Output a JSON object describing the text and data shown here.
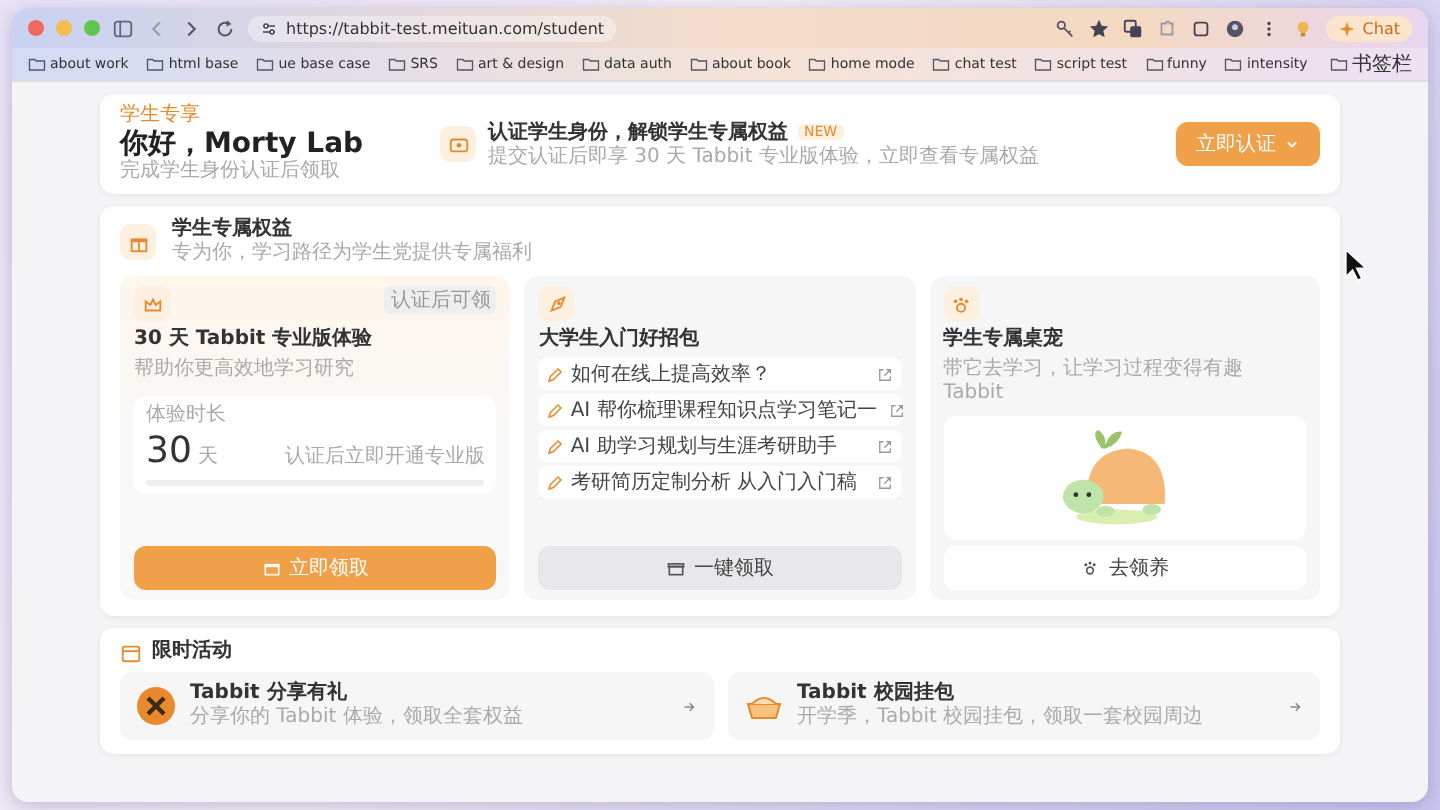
{
  "browser": {
    "url": "https://tabbit-test.meituan.com/student",
    "chat_button": "Chat",
    "bookmarks": [
      "about work",
      "html base",
      "ue base case",
      "SRS",
      "art & design",
      "data auth",
      "about book",
      "home mode",
      "chat test",
      "script test",
      "funny",
      "intensity",
      "书签栏"
    ]
  },
  "header": {
    "eyebrow": "学生专享",
    "greeting": "你好，Morty Lab",
    "subtitle": "完成学生身份认证后领取",
    "verify_title": "认证学生身份，解锁学生专属权益",
    "verify_badge": "NEW",
    "verify_text": "提交认证后即享 30 天 Tabbit 专业版体验，立即查看专属权益",
    "button": "立即认证"
  },
  "benefits": {
    "title": "学生专属权益",
    "subtitle": "专为你，学习路径为学生党提供专属福利",
    "cards": [
      {
        "kind": "trial",
        "title": "30 天 Tabbit 专业版体验",
        "text": "帮助你更高效地学习研究",
        "badge": "认证后可领",
        "counter_label": "体验时长",
        "counter_value": "30",
        "counter_unit": "天",
        "counter_note": "认证后立即开通专业版",
        "button": "立即领取"
      },
      {
        "kind": "pack",
        "title": "大学生入门好招包",
        "links": [
          "如何在线上提高效率？",
          "AI 帮你梳理课程知识点学习笔记一",
          "AI 助学习规划与生涯考研助手",
          "考研简历定制分析 从入门入门稿"
        ],
        "button": "一键领取"
      },
      {
        "kind": "pet",
        "title": "学生专属桌宠",
        "text": "带它去学习，让学习过程变得有趣 Tabbit",
        "button": "去领养"
      }
    ]
  },
  "events": {
    "title": "限时活动",
    "items": [
      {
        "kind": "share",
        "title": "Tabbit 分享有礼",
        "text": "分享你的 Tabbit 体验，领取全套权益"
      },
      {
        "kind": "campus",
        "title": "Tabbit 校园挂包",
        "text": "开学季，Tabbit 校园挂包，领取一套校园周边"
      }
    ]
  }
}
